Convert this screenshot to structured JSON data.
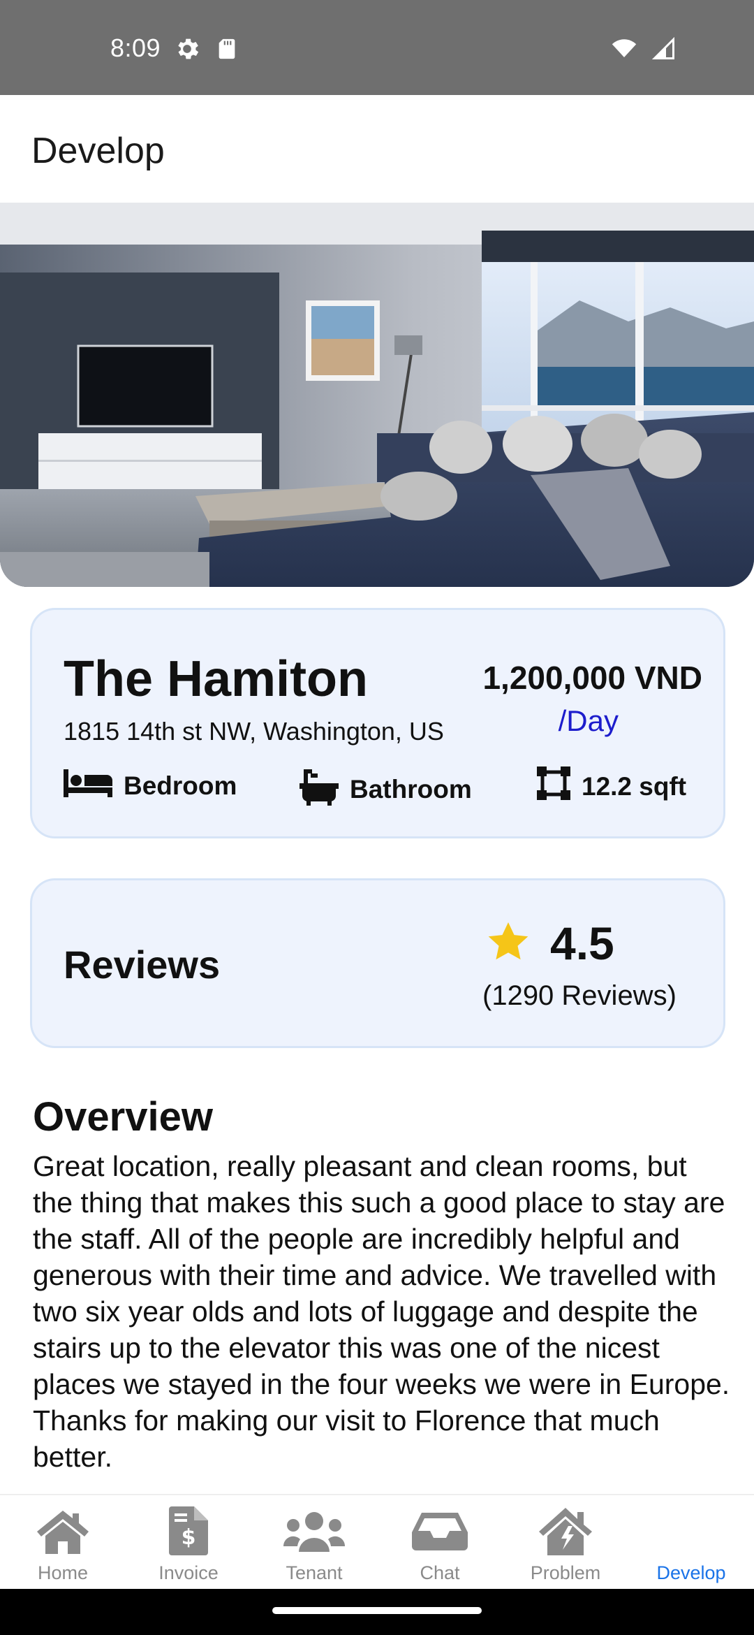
{
  "status_bar": {
    "time": "8:09"
  },
  "app_bar": {
    "title": "Develop"
  },
  "property": {
    "name": "The Hamiton",
    "address": "1815 14th st NW, Washington, US",
    "price": "1,200,000 VND",
    "price_period": "/Day",
    "features": {
      "bedroom": "Bedroom",
      "bathroom": "Bathroom",
      "size": "12.2 sqft"
    }
  },
  "reviews": {
    "title": "Reviews",
    "rating": "4.5",
    "count": "(1290 Reviews)"
  },
  "overview": {
    "title": "Overview",
    "text": "Great location, really pleasant and clean rooms, but the thing that makes this such a good place to stay are the staff. All of the people are incredibly helpful and generous with their time and advice. We travelled with two six year olds and lots of luggage and despite the stairs up to the elevator this was one of the nicest places we stayed in the four weeks we were in Europe. Thanks for making our visit to Florence that much better."
  },
  "bottom_nav": {
    "items": [
      {
        "label": "Home",
        "icon": "home-icon"
      },
      {
        "label": "Invoice",
        "icon": "invoice-icon"
      },
      {
        "label": "Tenant",
        "icon": "users-icon"
      },
      {
        "label": "Chat",
        "icon": "inbox-icon"
      },
      {
        "label": "Problem",
        "icon": "home-alert-icon"
      },
      {
        "label": "Develop",
        "icon": "develop-icon"
      }
    ],
    "active": "Develop"
  },
  "colors": {
    "accent": "#1a73e8",
    "price_period": "#1c1ccc",
    "card_bg": "#eef3fd",
    "card_border": "#d6e4f7",
    "star": "#f5c518",
    "nav_inactive": "#8a8a8a",
    "status_bar": "#6f6f6f"
  }
}
